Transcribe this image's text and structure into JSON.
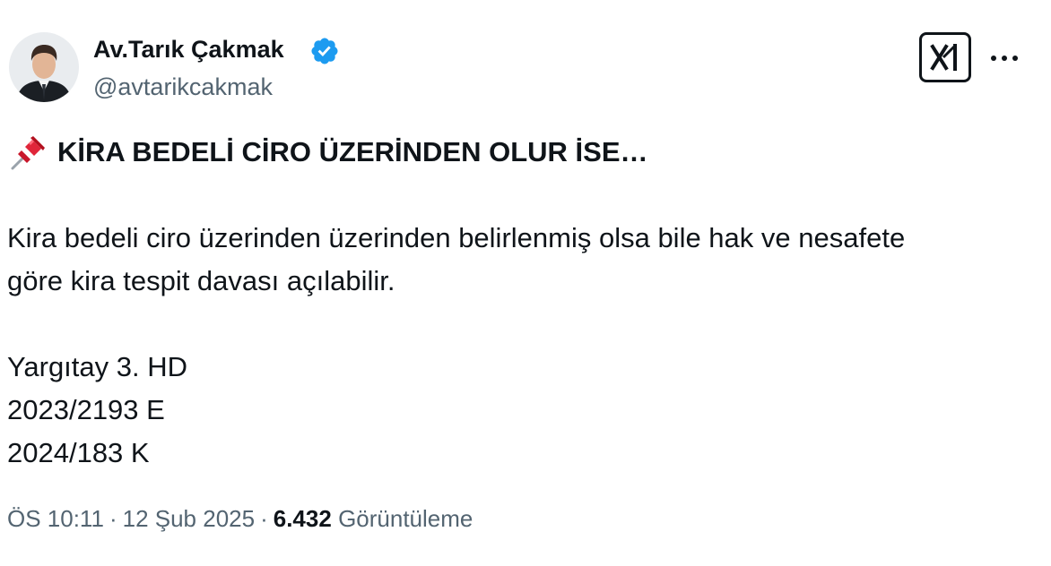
{
  "author": {
    "display_name": "Av.Tarık Çakmak",
    "handle": "@avtarikcakmak",
    "verified": true,
    "verified_color": "#1d9bf0"
  },
  "toolbar": {
    "grok_icon": "grok-icon",
    "more_label": "···"
  },
  "tweet": {
    "headline": "KİRA BEDELİ CİRO ÜZERİNDEN OLUR İSE…",
    "paragraph_line_1": "Kira bedeli ciro üzerinden üzerinden belirlenmiş olsa bile hak ve nesafete",
    "paragraph_line_2": "göre kira tespit davası açılabilir.",
    "reference_court": "Yargıtay 3. HD",
    "reference_e": "2023/2193 E",
    "reference_k": "2024/183 K"
  },
  "meta": {
    "time": "ÖS 10:11",
    "date": "12 Şub 2025",
    "separator": "·",
    "views_count": "6.432",
    "views_label": "Görüntüleme"
  },
  "colors": {
    "text_primary": "#0f1419",
    "text_secondary": "#536471",
    "pin_red": "#e0263a"
  }
}
